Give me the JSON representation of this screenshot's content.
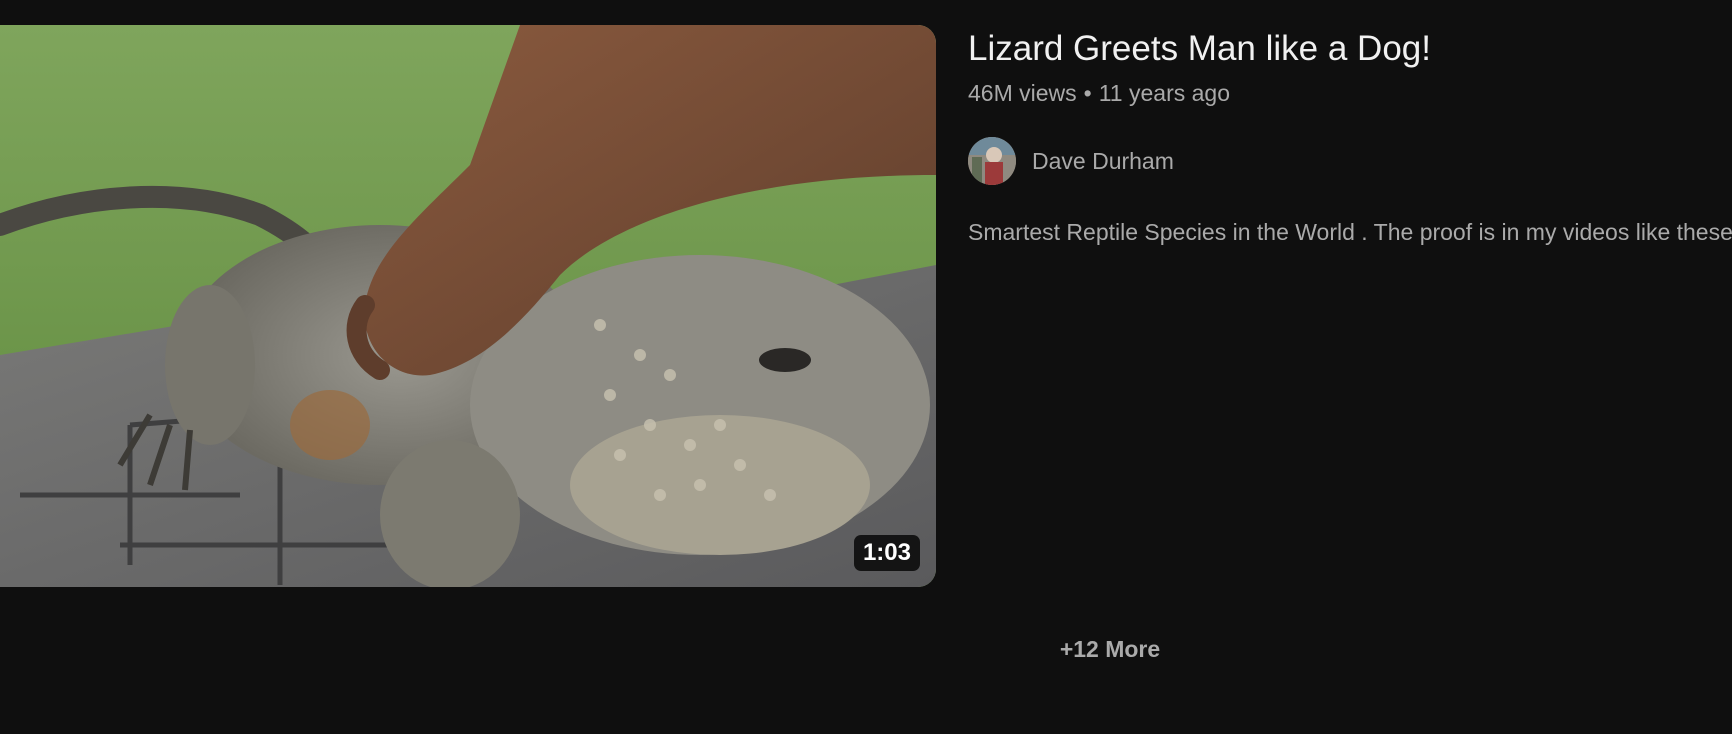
{
  "video": {
    "title": "Lizard Greets Man like a Dog!",
    "views": "46M views",
    "separator": "•",
    "age": "11 years ago",
    "duration": "1:03",
    "channel": "Dave Durham",
    "description": "Smartest Reptile Species in the World . The proof is in my videos like these"
  },
  "more_button": {
    "label": "+12 More"
  },
  "colors": {
    "background": "#0f0f0f",
    "title": "#f1f1f1",
    "secondary_text": "#aaaaaa"
  }
}
